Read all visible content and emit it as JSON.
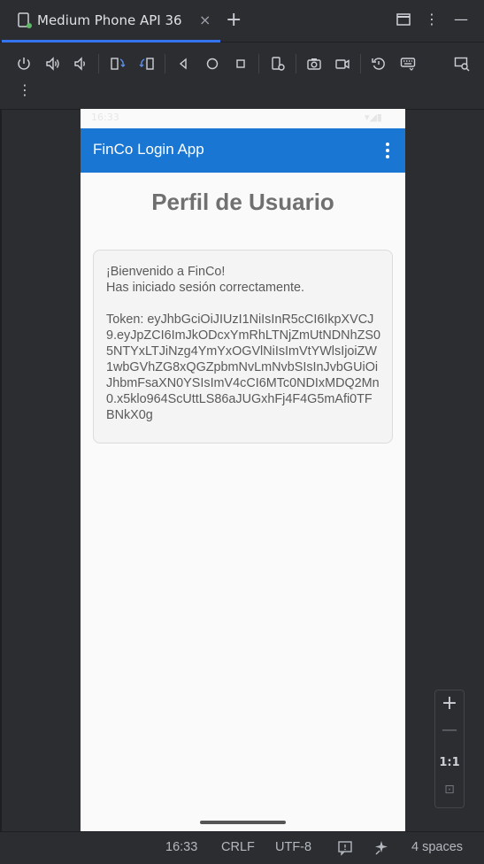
{
  "tab": {
    "title": "Medium Phone API 36",
    "close": "×",
    "add": "+"
  },
  "window": {
    "more": "⋮",
    "minimize": "—"
  },
  "toolbar": {
    "buttons": [
      "power-icon",
      "volume-up-icon",
      "volume-down-icon",
      "rotate-left-icon",
      "rotate-right-icon",
      "back-icon",
      "home-icon",
      "overview-icon",
      "device-settings-icon",
      "camera-icon",
      "record-icon",
      "reset-icon",
      "keyboard-icon",
      "snapshot-search-icon"
    ],
    "more": "⋮"
  },
  "phone": {
    "status_time": "16:33",
    "status_right": "▾◢▮",
    "app_title": "FinCo Login App",
    "page_title": "Perfil de Usuario",
    "card": {
      "welcome": "¡Bienvenido a FinCo!",
      "subtitle": "Has iniciado sesión correctamente.",
      "token_label": "Token: ",
      "token": "eyJhbGciOiJIUzI1NiIsInR5cCI6IkpXVCJ9.eyJpZCI6ImJkODcxYmRhLTNjZmUtNDNhZS05NTYxLTJiNzg4YmYxOGVlNiIsImVtYWlsIjoiZW1wbGVhZG8xQGZpbmNvLmNvbSIsInJvbGUiOiJhbmFsaXN0YSIsImV4cCI6MTc0NDIxMDQ2Mn0.x5klo964ScUttLS86aJUGxhFj4F4G5mAfi0TFBNkX0g"
    }
  },
  "zoom": {
    "in": "+",
    "out": "—",
    "actual": "1:1",
    "fit": "⊡"
  },
  "statusbar": {
    "time": "16:33",
    "line_ending": "CRLF",
    "encoding": "UTF-8",
    "indent": "4 spaces"
  },
  "colors": {
    "accent": "#3574f0",
    "appbar": "#1976d2",
    "ide_bg": "#2b2d30"
  }
}
